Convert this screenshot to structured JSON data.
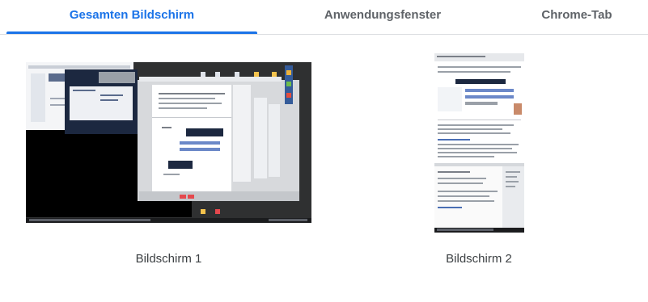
{
  "tabs": [
    {
      "label": "Gesamten Bildschirm",
      "selected": true
    },
    {
      "label": "Anwendungsfenster",
      "selected": false
    },
    {
      "label": "Chrome-Tab",
      "selected": false
    }
  ],
  "screens": [
    {
      "label": "Bildschirm 1"
    },
    {
      "label": "Bildschirm 2"
    }
  ],
  "colors": {
    "accent": "#1a73e8",
    "tab_text": "#5f6368",
    "caption_text": "#3c4043",
    "divider": "#dadce0"
  }
}
